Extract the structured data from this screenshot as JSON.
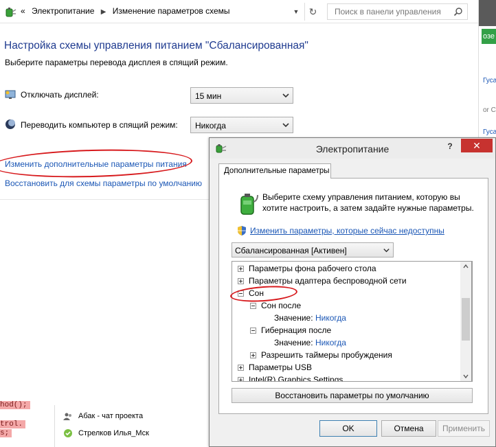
{
  "address_bar": {
    "nav_back": "«",
    "crumb_1": "Электропитание",
    "crumb_2": "Изменение параметров схемы",
    "search_placeholder": "Поиск в панели управления"
  },
  "plan_page": {
    "title": "Настройка схемы управления питанием \"Сбалансированная\"",
    "subtitle": "Выберите параметры перевода дисплея в спящий режим.",
    "display_off_label": "Отключать дисплей:",
    "display_off_value": "15 мин",
    "sleep_label": "Переводить компьютер в спящий режим:",
    "sleep_value": "Никогда",
    "advanced_link": "Изменить дополнительные параметры питания",
    "restore_link": "Восстановить для схемы параметры по умолчанию"
  },
  "right_strip": {
    "green_tile": "озе",
    "text_1": "Гуса",
    "text_2": "or Ch",
    "text_3": "Гуса"
  },
  "code_snippet": [
    "hod();",
    "trol.",
    "s;"
  ],
  "chat": {
    "item_1": "Абак - чат проекта",
    "item_2": "Стрелков Илья_Мск"
  },
  "dialog": {
    "title": "Электропитание",
    "help": "?",
    "close": "✕",
    "tab": "Дополнительные параметры",
    "intro_line_1": "Выберите схему управления питанием, которую вы",
    "intro_line_2": "хотите настроить, а затем задайте нужные параметры.",
    "unavailable_link": "Изменить параметры, которые сейчас недоступны",
    "scheme_value": "Сбалансированная [Активен]",
    "tree": {
      "desktop_bg": "Параметры фона рабочего стола",
      "wireless": "Параметры адаптера беспроводной сети",
      "sleep": "Сон",
      "sleep_after": "Сон после",
      "value_label": "Значение:",
      "sleep_after_value": "Никогда",
      "hibernate_after": "Гибернация после",
      "hibernate_after_value": "Никогда",
      "wake_timers": "Разрешить таймеры пробуждения",
      "usb": "Параметры USB",
      "intel": "Intel(R) Graphics Settings"
    },
    "restore_defaults": "Восстановить параметры по умолчанию",
    "ok": "OK",
    "cancel": "Отмена",
    "apply": "Применить"
  },
  "colors": {
    "link": "#1a56b5",
    "title_blue": "#1e3a8f",
    "close_red": "#c7322f",
    "annotation_red": "#d7191c"
  }
}
